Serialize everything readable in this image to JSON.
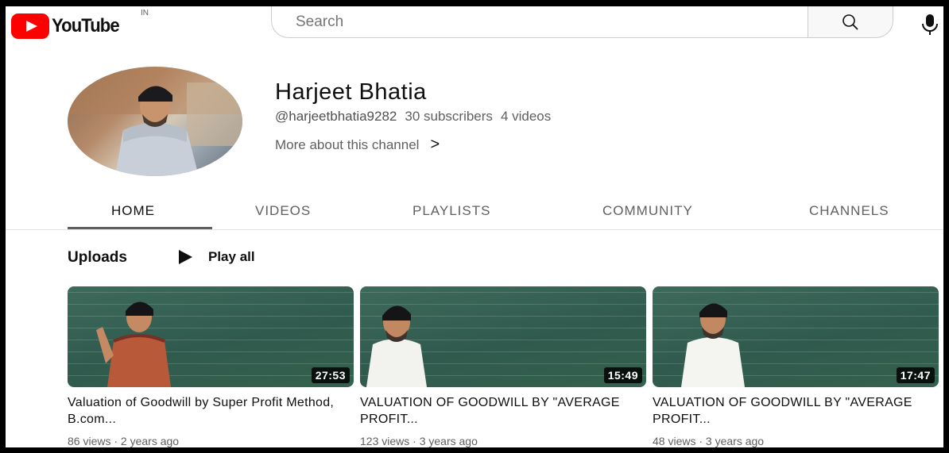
{
  "header": {
    "logo_text": "YouTube",
    "region": "IN",
    "search_placeholder": "Search",
    "brand_color": "#ff0000"
  },
  "channel": {
    "name": "Harjeet Bhatia",
    "handle": "@harjeetbhatia9282",
    "subscribers": "30 subscribers",
    "video_count": "4 videos",
    "more_about": "More about this channel",
    "more_chevron": ">"
  },
  "tabs": [
    {
      "label": "HOME",
      "active": true
    },
    {
      "label": "VIDEOS",
      "active": false
    },
    {
      "label": "PLAYLISTS",
      "active": false
    },
    {
      "label": "COMMUNITY",
      "active": false
    },
    {
      "label": "CHANNELS",
      "active": false
    }
  ],
  "uploads": {
    "title": "Uploads",
    "play_all": "Play all",
    "videos": [
      {
        "title": "Valuation of Goodwill by Super Profit Method, B.com...",
        "duration": "27:53",
        "views": "86 views",
        "age": "2 years ago"
      },
      {
        "title": "VALUATION OF GOODWILL BY \"AVERAGE PROFIT...",
        "duration": "15:49",
        "views": "123 views",
        "age": "3 years ago"
      },
      {
        "title": "VALUATION OF GOODWILL BY \"AVERAGE PROFIT...",
        "duration": "17:47",
        "views": "48 views",
        "age": "3 years ago"
      }
    ]
  }
}
